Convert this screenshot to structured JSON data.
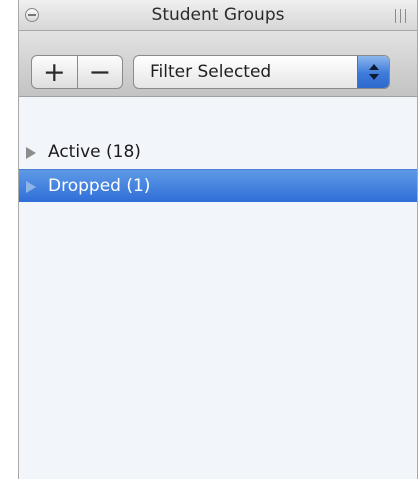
{
  "window": {
    "title": "Student Groups"
  },
  "toolbar": {
    "add_label": "+",
    "remove_label": "−",
    "filter": {
      "selected": "Filter Selected"
    }
  },
  "groups": [
    {
      "label": "Active (18)",
      "selected": false
    },
    {
      "label": "Dropped (1)",
      "selected": true
    }
  ],
  "colors": {
    "selection": "#3a7be0",
    "panel_background": "#f2f5fa",
    "stepper_blue": "#3d7ad9"
  }
}
